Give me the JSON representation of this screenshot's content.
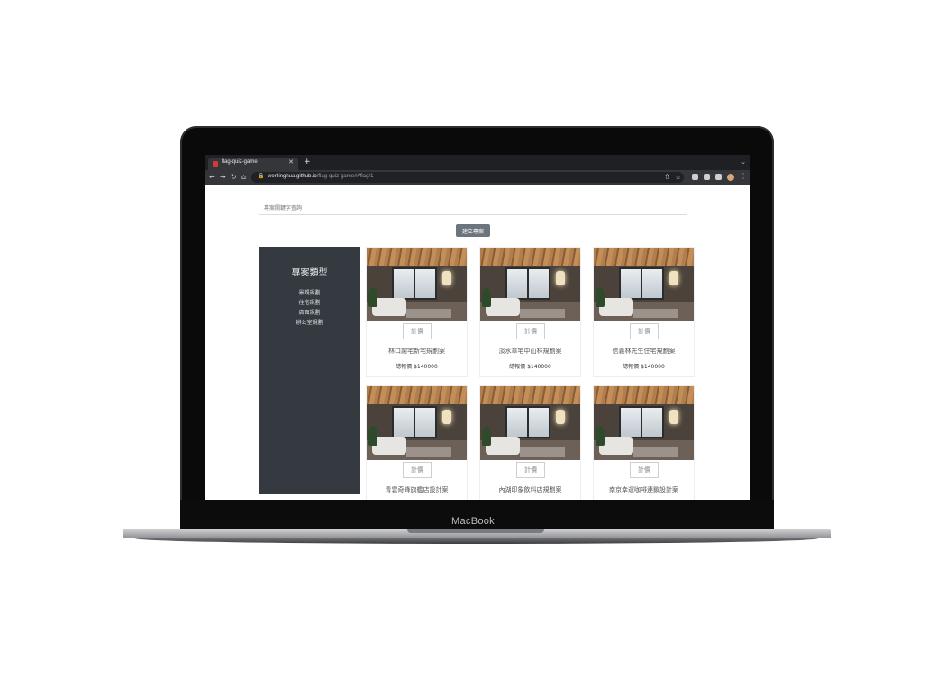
{
  "device": {
    "brand_label": "MacBook"
  },
  "browser": {
    "tab": {
      "title": "flag-quiz-game",
      "favicon_color": "#d13a3a"
    },
    "url": {
      "host": "wenlinghua.github.io",
      "path": "/flag-quiz-game/#/flag/1"
    }
  },
  "page": {
    "search": {
      "placeholder": "專案關鍵字查詢"
    },
    "create_button": {
      "label": "建立專案"
    },
    "sidebar": {
      "title": "專案類型",
      "items": [
        "景觀規劃",
        "住宅規劃",
        "店面規劃",
        "辦公室規劃"
      ]
    },
    "cards": [
      {
        "tag": "計價",
        "title": "林口謝宅新宅規劃案",
        "price": "總報價 $140000"
      },
      {
        "tag": "計價",
        "title": "淡水章宅中山林規劃案",
        "price": "總報價 $140000"
      },
      {
        "tag": "計價",
        "title": "信義林先生住宅規劃案",
        "price": "總報價 $140000"
      },
      {
        "tag": "計價",
        "title": "青雲奇峰旗艦店設計案",
        "price": ""
      },
      {
        "tag": "計價",
        "title": "內湖印象飲料店規劃案",
        "price": ""
      },
      {
        "tag": "計價",
        "title": "南京幸運咖啡連鎖設計案",
        "price": ""
      }
    ]
  },
  "colors": {
    "sidebar_bg": "#343a40",
    "button_bg": "#6c757d",
    "chrome_bg": "#35363a"
  }
}
